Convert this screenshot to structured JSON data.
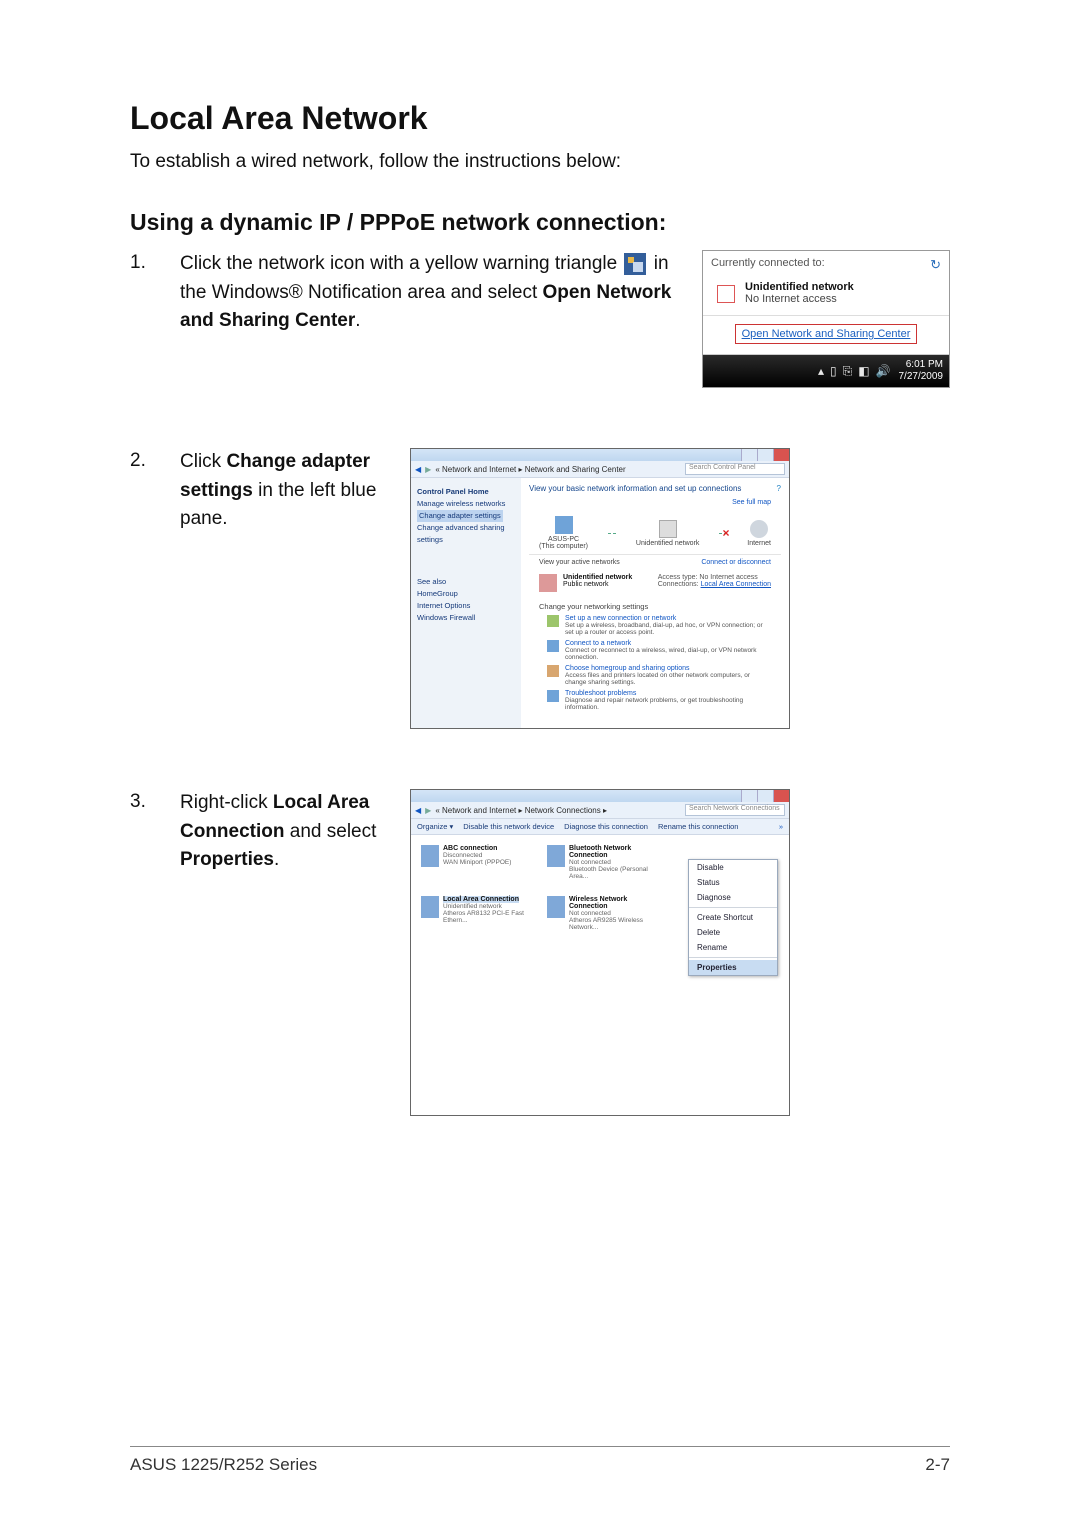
{
  "title": "Local Area Network",
  "intro": "To establish a wired network, follow the instructions below:",
  "subtitle": "Using a dynamic IP / PPPoE network connection:",
  "steps": {
    "s1": {
      "num": "1.",
      "t1": "Click the network icon with a yellow warning triangle ",
      "t2": " in the Windows® Notification area and select ",
      "bold": "Open Network and Sharing Center",
      "period": "."
    },
    "s2": {
      "num": "2.",
      "t1": "Click ",
      "bold": "Change adapter settings",
      "t2": " in the left blue pane."
    },
    "s3": {
      "num": "3.",
      "t1": "Right-click ",
      "bold1": "Local Area Connection",
      "t2": " and select ",
      "bold2": "Properties",
      "period": "."
    }
  },
  "fig1": {
    "connected_to": "Currently connected to:",
    "net_name": "Unidentified network",
    "net_sub": "No Internet access",
    "open_link": "Open Network and Sharing Center",
    "time": "6:01 PM",
    "date": "7/27/2009",
    "tray_glyphs": [
      "▴",
      "▯",
      "⎘",
      "◧",
      "🔊"
    ]
  },
  "fig2": {
    "breadcrumb": "« Network and Internet ▸ Network and Sharing Center",
    "search_ph": "Search Control Panel",
    "side": {
      "home": "Control Panel Home",
      "wireless": "Manage wireless networks",
      "adapter": "Change adapter settings",
      "adv": "Change advanced sharing settings",
      "seealso": "See also",
      "hg": "HomeGroup",
      "io": "Internet Options",
      "wf": "Windows Firewall"
    },
    "main": {
      "t1": "View your basic network information and set up connections",
      "help": "?",
      "pc": "ASUS-PC",
      "pc_sub": "(This computer)",
      "un": "Unidentified network",
      "inet": "Internet",
      "fullmap": "See full map",
      "act": "View your active networks",
      "act_r": "Connect or disconnect",
      "unet_name": "Unidentified network",
      "unet_sub": "Public network",
      "acc_l": "Access type:",
      "acc_v": "No Internet access",
      "con_l": "Connections:",
      "con_v": "Local Area Connection",
      "chg": "Change your networking settings",
      "o1t": "Set up a new connection or network",
      "o1d": "Set up a wireless, broadband, dial-up, ad hoc, or VPN connection; or set up a router or access point.",
      "o2t": "Connect to a network",
      "o2d": "Connect or reconnect to a wireless, wired, dial-up, or VPN network connection.",
      "o3t": "Choose homegroup and sharing options",
      "o3d": "Access files and printers located on other network computers, or change sharing settings.",
      "o4t": "Troubleshoot problems",
      "o4d": "Diagnose and repair network problems, or get troubleshooting information."
    }
  },
  "fig3": {
    "breadcrumb": "« Network and Internet ▸ Network Connections ▸",
    "search_ph": "Search Network Connections",
    "bar": {
      "org": "Organize ▾",
      "dis": "Disable this network device",
      "diag": "Diagnose this connection",
      "ren": "Rename this connection",
      "more": "»"
    },
    "c1": {
      "n": "ABC connection",
      "s1": "Disconnected",
      "s2": "WAN Miniport (PPPOE)"
    },
    "c2": {
      "n": "Bluetooth Network Connection",
      "s1": "Not connected",
      "s2": "Bluetooth Device (Personal Area..."
    },
    "c3": {
      "n": "Local Area Connection",
      "s1": "Unidentified network",
      "s2": "Atheros AR8132 PCI-E Fast Ethern..."
    },
    "c4": {
      "n": "Wireless Network Connection",
      "s1": "Not connected",
      "s2": "Atheros AR9285 Wireless Network..."
    },
    "menu": {
      "m1": "Disable",
      "m2": "Status",
      "m3": "Diagnose",
      "m4": "Create Shortcut",
      "m5": "Delete",
      "m6": "Rename",
      "m7": "Properties"
    }
  },
  "footer": {
    "left": "ASUS 1225/R252 Series",
    "right": "2-7"
  }
}
